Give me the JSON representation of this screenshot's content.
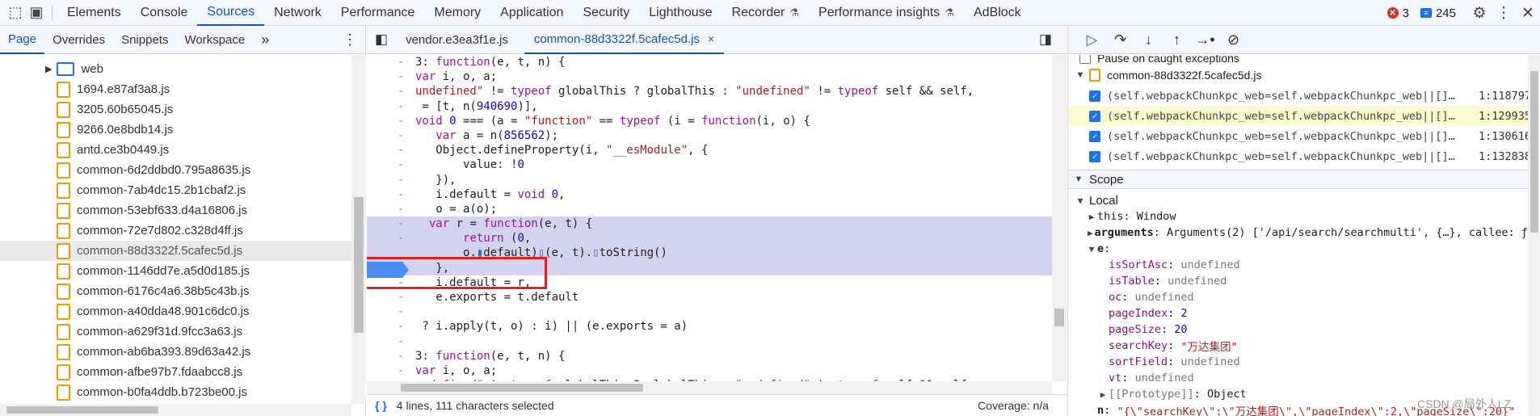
{
  "topbar": {
    "tabs": [
      "Elements",
      "Console",
      "Sources",
      "Network",
      "Performance",
      "Memory",
      "Application",
      "Security",
      "Lighthouse",
      "Recorder",
      "Performance insights",
      "AdBlock"
    ],
    "active_tab": "Sources",
    "errors_count": "3",
    "messages_count": "245"
  },
  "navigator": {
    "tabs": [
      "Page",
      "Overrides",
      "Snippets",
      "Workspace"
    ],
    "more": "»",
    "folder": "web",
    "files": [
      "1694.e87af3a8.js",
      "3205.60b65045.js",
      "9266.0e8bdb14.js",
      "antd.ce3b0449.js",
      "common-6d2ddbd0.795a8635.js",
      "common-7ab4dc15.2b1cbaf2.js",
      "common-53ebf633.d4a16806.js",
      "common-72e7d802.c328d4ff.js",
      "common-88d3322f.5cafec5d.js",
      "common-1146dd7e.a5d0d185.js",
      "common-6176c4a6.38b5c43b.js",
      "common-a40dda48.901c6dc0.js",
      "common-a629f31d.9fcc3a63.js",
      "common-ab6ba393.89d63a42.js",
      "common-afbe97b7.fdaabcc8.js",
      "common-b0fa4ddb.b723be00.js"
    ],
    "selected_file": "common-88d3322f.5cafec5d.js"
  },
  "editor": {
    "tabs": [
      "vendor.e3ea3f1e.js",
      "common-88d3322f.5cafec5d.js"
    ],
    "close_symbol": "×",
    "status_selection": "4 lines, 111 characters selected",
    "coverage": "Coverage: n/a"
  },
  "debugger": {
    "pause_caught": "Pause on caught exceptions",
    "bp_file": "common-88d3322f.5cafec5d.js",
    "breakpoints": [
      {
        "code": "(self.webpackChunkpc_web=self.webpackChunkpc_web||[]…",
        "loc": "1:118797"
      },
      {
        "code": "(self.webpackChunkpc_web=self.webpackChunkpc_web||[]…",
        "loc": "1:129935"
      },
      {
        "code": "(self.webpackChunkpc_web=self.webpackChunkpc_web||[]…",
        "loc": "1:130616"
      },
      {
        "code": "(self.webpackChunkpc_web=self.webpackChunkpc_web||[]…",
        "loc": "1:132838"
      }
    ],
    "scope_title": "Scope",
    "local_title": "Local",
    "this_key": "this",
    "this_val": "Window",
    "args_key": "arguments",
    "args_val": "Arguments(2) ['/api/search/searchmulti', {…}, callee: ƒ",
    "e_key": "e",
    "props": [
      {
        "k": "isSortAsc",
        "v": "undefined",
        "t": "und"
      },
      {
        "k": "isTable",
        "v": "undefined",
        "t": "und"
      },
      {
        "k": "oc",
        "v": "undefined",
        "t": "und"
      },
      {
        "k": "pageIndex",
        "v": "2",
        "t": "num"
      },
      {
        "k": "pageSize",
        "v": "20",
        "t": "num"
      },
      {
        "k": "searchKey",
        "v": "\"万达集团\"",
        "t": "str"
      },
      {
        "k": "sortField",
        "v": "undefined",
        "t": "und"
      },
      {
        "k": "vt",
        "v": "undefined",
        "t": "und"
      }
    ],
    "proto_key": "[[Prototype]]",
    "proto_val": "Object",
    "n_key": "n",
    "n_val": "\"{\\\"searchKey\\\":\\\"万达集团\\\",\\\"pageIndex\\\":2,\\\"pageSize\\\":20}\""
  },
  "watermark": "CSDN @局外人LZ"
}
